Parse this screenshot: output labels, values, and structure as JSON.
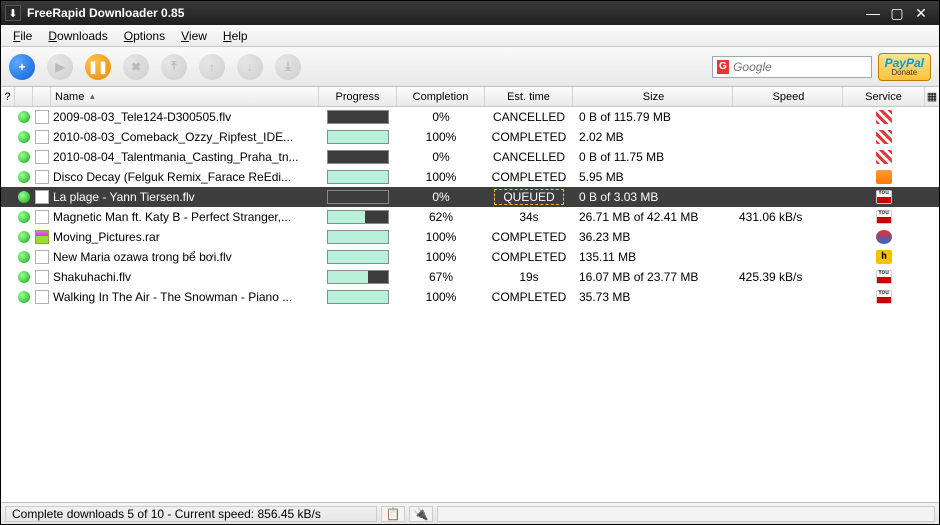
{
  "window": {
    "title": "FreeRapid Downloader 0.85"
  },
  "menu": {
    "file": "File",
    "downloads": "Downloads",
    "options": "Options",
    "view": "View",
    "help": "Help"
  },
  "toolbar": {
    "add": "+",
    "play": "▶",
    "pause": "❚❚",
    "stop": "✖",
    "search_placeholder": "Google",
    "paypal_top": "Pay",
    "paypal_top2": "Pal",
    "paypal_bottom": "Donate"
  },
  "columns": {
    "q": "?",
    "name": "Name",
    "progress": "Progress",
    "completion": "Completion",
    "est": "Est. time",
    "size": "Size",
    "speed": "Speed",
    "service": "Service"
  },
  "rows": [
    {
      "name": "2009-08-03_Tele124-D300505.flv",
      "progress_pct": 0,
      "progress_color": "pink",
      "completion": "0%",
      "est": "CANCELLED",
      "size": "0 B of 115.79 MB",
      "speed": "",
      "service": "stripe",
      "selected": false
    },
    {
      "name": "2010-08-03_Comeback_Ozzy_Ripfest_IDE...",
      "progress_pct": 100,
      "progress_color": "full",
      "completion": "100%",
      "est": "COMPLETED",
      "size": "2.02 MB",
      "speed": "",
      "service": "stripe",
      "selected": false
    },
    {
      "name": "2010-08-04_Talentmania_Casting_Praha_tn...",
      "progress_pct": 0,
      "progress_color": "pink",
      "completion": "0%",
      "est": "CANCELLED",
      "size": "0 B of 11.75 MB",
      "speed": "",
      "service": "stripe",
      "selected": false
    },
    {
      "name": "Disco Decay (Felguk Remix_Farace ReEdi...",
      "progress_pct": 100,
      "progress_color": "full",
      "completion": "100%",
      "est": "COMPLETED",
      "size": "5.95 MB",
      "speed": "",
      "service": "cloud",
      "selected": false
    },
    {
      "name": "La plage - Yann Tiersen.flv",
      "progress_pct": 0,
      "progress_color": "cream",
      "completion": "0%",
      "est": "QUEUED",
      "size": "0 B of 3.03 MB",
      "speed": "",
      "service": "yt",
      "selected": true
    },
    {
      "name": "Magnetic Man ft. Katy B - Perfect Stranger,...",
      "progress_pct": 62,
      "progress_color": "teal",
      "completion": "62%",
      "est": "34s",
      "size": "26.71 MB of 42.41 MB",
      "speed": "431.06 kB/s",
      "service": "yt",
      "selected": false
    },
    {
      "name": "Moving_Pictures.rar",
      "progress_pct": 100,
      "progress_color": "full",
      "completion": "100%",
      "est": "COMPLETED",
      "size": "36.23 MB",
      "speed": "",
      "service": "swirl",
      "selected": false,
      "icon": "rar"
    },
    {
      "name": "New Maria ozawa trong bể bơi.flv",
      "progress_pct": 100,
      "progress_color": "full",
      "completion": "100%",
      "est": "COMPLETED",
      "size": "135.11 MB",
      "speed": "",
      "service": "h",
      "selected": false
    },
    {
      "name": "Shakuhachi.flv",
      "progress_pct": 67,
      "progress_color": "teal",
      "completion": "67%",
      "est": "19s",
      "size": "16.07 MB of 23.77 MB",
      "speed": "425.39 kB/s",
      "service": "yt",
      "selected": false
    },
    {
      "name": "Walking In The Air - The Snowman - Piano ...",
      "progress_pct": 100,
      "progress_color": "full",
      "completion": "100%",
      "est": "COMPLETED",
      "size": "35.73 MB",
      "speed": "",
      "service": "yt",
      "selected": false
    }
  ],
  "status": {
    "text": "Complete downloads 5 of 10 - Current speed: 856.45 kB/s"
  }
}
